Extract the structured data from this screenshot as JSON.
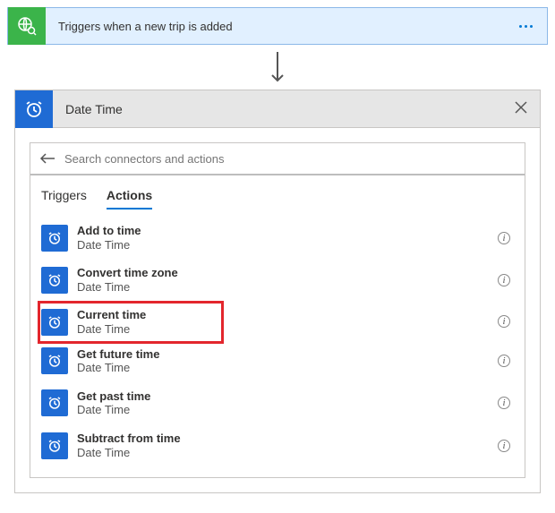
{
  "trigger": {
    "title": "Triggers when a new trip is added"
  },
  "panel": {
    "title": "Date Time"
  },
  "search": {
    "placeholder": "Search connectors and actions"
  },
  "tabs": {
    "triggers": "Triggers",
    "actions": "Actions"
  },
  "items": [
    {
      "title": "Add to time",
      "sub": "Date Time"
    },
    {
      "title": "Convert time zone",
      "sub": "Date Time"
    },
    {
      "title": "Current time",
      "sub": "Date Time"
    },
    {
      "title": "Get future time",
      "sub": "Date Time"
    },
    {
      "title": "Get past time",
      "sub": "Date Time"
    },
    {
      "title": "Subtract from time",
      "sub": "Date Time"
    }
  ],
  "info": "i"
}
